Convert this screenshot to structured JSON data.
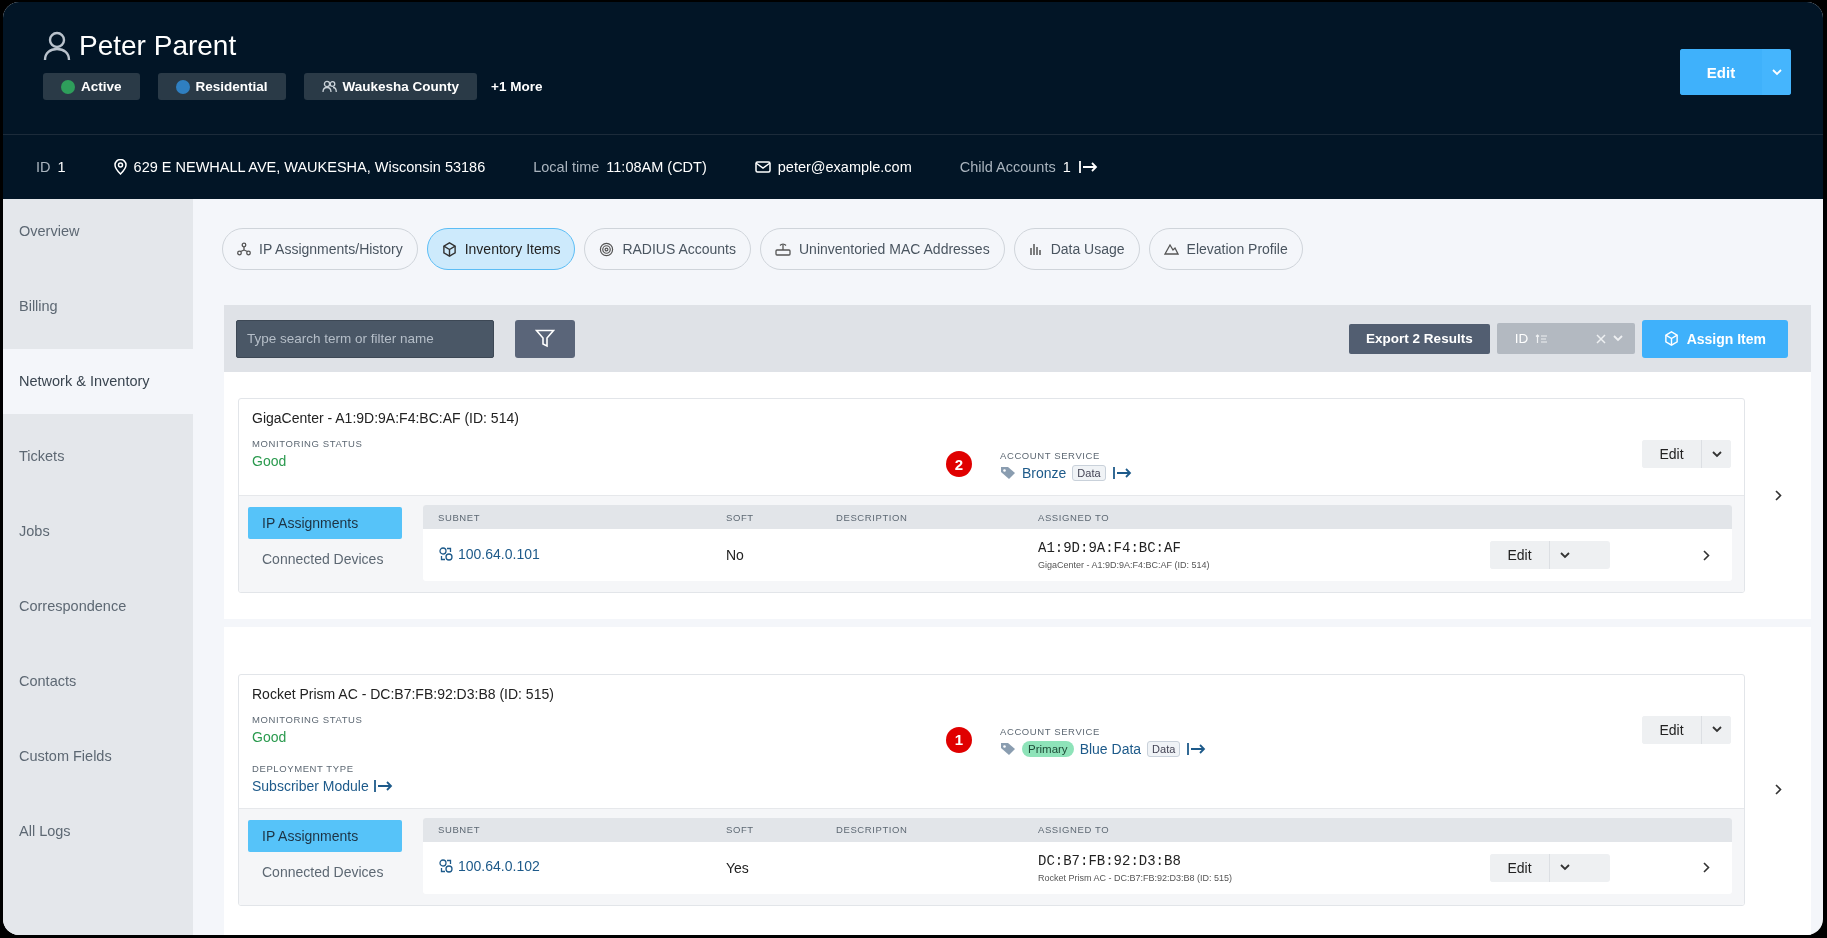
{
  "customer": {
    "name": "Peter Parent",
    "more": "+1 More",
    "tags": [
      {
        "label": "Active",
        "kind": "dot",
        "color": "#2e9e5b"
      },
      {
        "label": "Residential",
        "kind": "dot",
        "color": "#2f7fc1"
      },
      {
        "label": "Waukesha County",
        "kind": "group"
      }
    ]
  },
  "header_button": {
    "label": "Edit"
  },
  "info_bar": {
    "id_label": "ID",
    "id": "1",
    "address": "629 E NEWHALL AVE, WAUKESHA, Wisconsin 53186",
    "local_time_label": "Local time",
    "local_time": "11:08AM (CDT)",
    "email": "peter@example.com",
    "child_accounts_label": "Child Accounts",
    "child_accounts": "1"
  },
  "sidebar": {
    "items": [
      {
        "label": "Overview",
        "selected": false
      },
      {
        "label": "Billing",
        "selected": false
      },
      {
        "label": "Network & Inventory",
        "selected": true
      },
      {
        "label": "Tickets",
        "selected": false
      },
      {
        "label": "Jobs",
        "selected": false
      },
      {
        "label": "Correspondence",
        "selected": false
      },
      {
        "label": "Contacts",
        "selected": false
      },
      {
        "label": "Custom Fields",
        "selected": false
      },
      {
        "label": "All Logs",
        "selected": false
      }
    ]
  },
  "tabs": [
    {
      "label": "IP Assignments/History",
      "selected": false
    },
    {
      "label": "Inventory Items",
      "selected": true
    },
    {
      "label": "RADIUS Accounts",
      "selected": false
    },
    {
      "label": "Uninventoried MAC Addresses",
      "selected": false
    },
    {
      "label": "Data Usage",
      "selected": false
    },
    {
      "label": "Elevation Profile",
      "selected": false
    }
  ],
  "toolbar": {
    "search_placeholder": "Type search term or filter name",
    "export": "Export 2 Results",
    "sort_field": "ID",
    "assign": "Assign Item"
  },
  "items": [
    {
      "title": "GigaCenter - A1:9D:9A:F4:BC:AF (ID: 514)",
      "marker": "2",
      "edit": "Edit",
      "fields": [
        {
          "label": "MONITORING STATUS",
          "value": "Good",
          "kind": "status"
        }
      ],
      "service": {
        "label": "ACCOUNT SERVICE",
        "name": "Bronze",
        "tag": "Data"
      },
      "subtabs": [
        {
          "label": "IP Assignments",
          "selected": true
        },
        {
          "label": "Connected Devices",
          "selected": false
        }
      ],
      "table": {
        "columns": [
          "SUBNET",
          "SOFT",
          "DESCRIPTION",
          "ASSIGNED TO"
        ],
        "rows": [
          {
            "subnet": "100.64.0.101",
            "soft": "No",
            "assigned_to": "A1:9D:9A:F4:BC:AF",
            "assigned_detail": "GigaCenter - A1:9D:9A:F4:BC:AF (ID: 514)",
            "edit": "Edit"
          }
        ]
      }
    },
    {
      "title": "Rocket Prism AC - DC:B7:FB:92:D3:B8 (ID: 515)",
      "marker": "1",
      "edit": "Edit",
      "fields": [
        {
          "label": "MONITORING STATUS",
          "value": "Good",
          "kind": "status"
        },
        {
          "label": "DEPLOYMENT TYPE",
          "value": "Subscriber Module",
          "kind": "link"
        }
      ],
      "service": {
        "label": "ACCOUNT SERVICE",
        "badge": "Primary",
        "name": "Blue Data",
        "tag": "Data"
      },
      "subtabs": [
        {
          "label": "IP Assignments",
          "selected": true
        },
        {
          "label": "Connected Devices",
          "selected": false
        }
      ],
      "table": {
        "columns": [
          "SUBNET",
          "SOFT",
          "DESCRIPTION",
          "ASSIGNED TO"
        ],
        "rows": [
          {
            "subnet": "100.64.0.102",
            "soft": "Yes",
            "assigned_to": "DC:B7:FB:92:D3:B8",
            "assigned_detail": "Rocket Prism AC - DC:B7:FB:92:D3:B8 (ID: 515)",
            "edit": "Edit"
          }
        ]
      }
    }
  ]
}
